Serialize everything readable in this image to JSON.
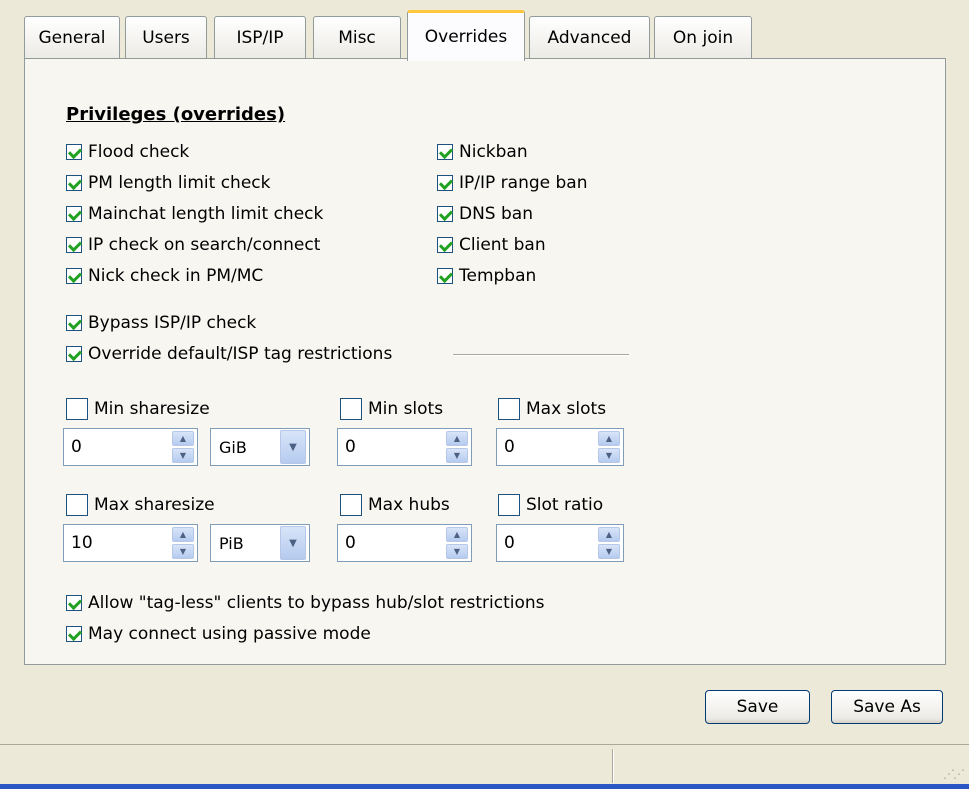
{
  "tabs": [
    {
      "label": "General"
    },
    {
      "label": "Users"
    },
    {
      "label": "ISP/IP"
    },
    {
      "label": "Misc"
    },
    {
      "label": "Overrides",
      "active": true
    },
    {
      "label": "Advanced"
    },
    {
      "label": "On join"
    }
  ],
  "section_title": "Privileges (overrides)",
  "checks": {
    "flood_check": {
      "label": "Flood check",
      "checked": true
    },
    "pm_length": {
      "label": "PM length limit check",
      "checked": true
    },
    "mainchat_length": {
      "label": "Mainchat length limit check",
      "checked": true
    },
    "ip_check": {
      "label": "IP check on search/connect",
      "checked": true
    },
    "nick_check": {
      "label": "Nick check in PM/MC",
      "checked": true
    },
    "nickban": {
      "label": "Nickban",
      "checked": true
    },
    "ip_range_ban": {
      "label": "IP/IP range ban",
      "checked": true
    },
    "dns_ban": {
      "label": "DNS ban",
      "checked": true
    },
    "client_ban": {
      "label": "Client ban",
      "checked": true
    },
    "tempban": {
      "label": "Tempban",
      "checked": true
    },
    "bypass_isp": {
      "label": "Bypass ISP/IP check",
      "checked": true
    },
    "override_tag": {
      "label": "Override default/ISP tag restrictions",
      "checked": true
    },
    "min_sharesize": {
      "label": "Min sharesize",
      "checked": false
    },
    "min_slots": {
      "label": "Min slots",
      "checked": false
    },
    "max_slots": {
      "label": "Max slots",
      "checked": false
    },
    "max_sharesize": {
      "label": "Max sharesize",
      "checked": false
    },
    "max_hubs": {
      "label": "Max hubs",
      "checked": false
    },
    "slot_ratio": {
      "label": "Slot ratio",
      "checked": false
    },
    "tagless": {
      "label": "Allow \"tag-less\" clients to bypass hub/slot restrictions",
      "checked": true
    },
    "passive": {
      "label": "May connect using passive mode",
      "checked": true
    }
  },
  "fields": {
    "min_sharesize_value": "0",
    "min_sharesize_unit": "GiB",
    "min_slots_value": "0",
    "max_slots_value": "0",
    "max_sharesize_value": "10",
    "max_sharesize_unit": "PiB",
    "max_hubs_value": "0",
    "slot_ratio_value": "0"
  },
  "buttons": {
    "save": "Save",
    "save_as": "Save As"
  }
}
